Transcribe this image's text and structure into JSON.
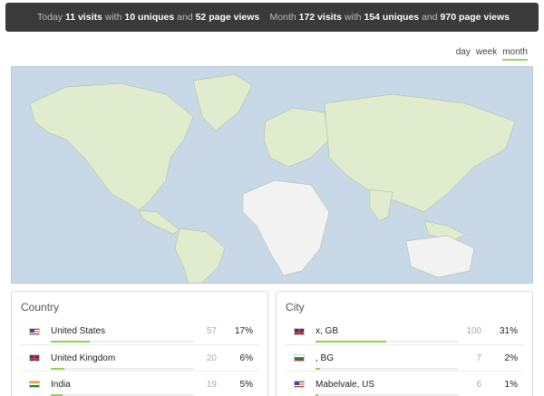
{
  "summary": {
    "today": {
      "label": "Today",
      "visits": "11 visits",
      "with": "with",
      "uniques": "10 uniques",
      "and": "and",
      "pageviews": "52 page views"
    },
    "month": {
      "label": "Month",
      "visits": "172 visits",
      "with": "with",
      "uniques": "154 uniques",
      "and": "and",
      "pageviews": "970 page views"
    }
  },
  "range": {
    "options": [
      "day",
      "week",
      "month"
    ],
    "selected": "month"
  },
  "colors": {
    "accent": "#8fcf5a",
    "header_bg": "#3a3a3a",
    "ocean": "#c8d8e6",
    "land": "#dfeccd"
  },
  "country": {
    "title": "Country",
    "rows": [
      {
        "flag": "us-flag-icon",
        "name": "United States",
        "count": "57",
        "pct": "17%",
        "share": 0.17
      },
      {
        "flag": "gb-flag-icon",
        "name": "United Kingdom",
        "count": "20",
        "pct": "6%",
        "share": 0.06
      },
      {
        "flag": "in-flag-icon",
        "name": "India",
        "count": "19",
        "pct": "5%",
        "share": 0.05
      }
    ]
  },
  "city": {
    "title": "City",
    "rows": [
      {
        "flag": "gb-flag-icon",
        "name": "x, GB",
        "count": "100",
        "pct": "31%",
        "share": 0.31
      },
      {
        "flag": "bg-flag-icon",
        "name": ", BG",
        "count": "7",
        "pct": "2%",
        "share": 0.02
      },
      {
        "flag": "us-flag-icon",
        "name": "Mabelvale, US",
        "count": "6",
        "pct": "1%",
        "share": 0.01
      }
    ]
  }
}
